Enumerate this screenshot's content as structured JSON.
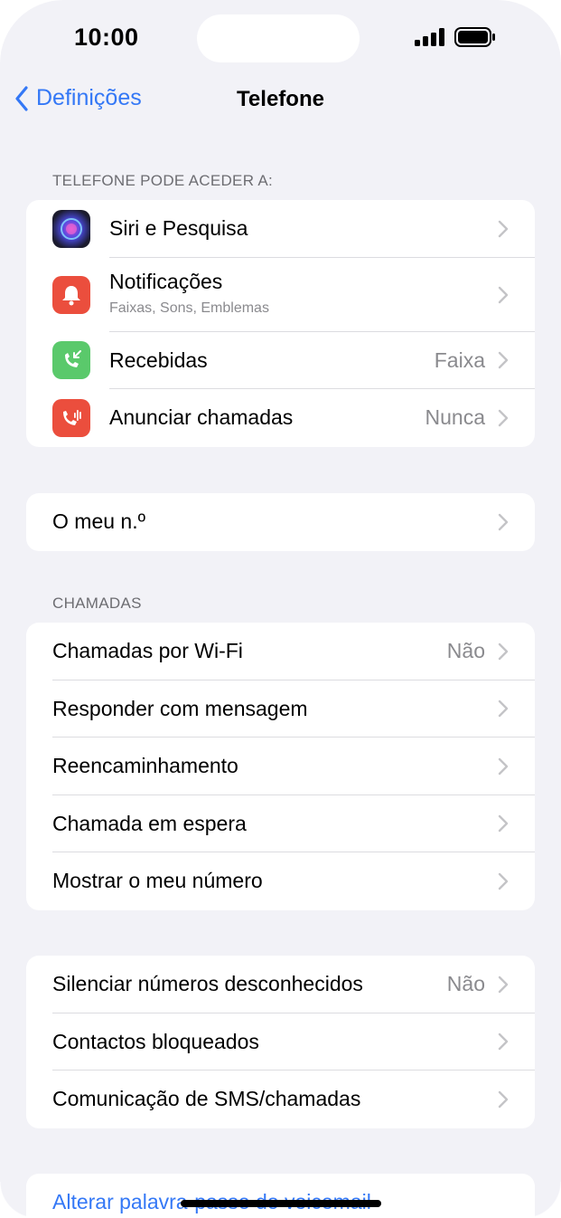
{
  "status": {
    "time": "10:00"
  },
  "nav": {
    "back_label": "Definições",
    "title": "Telefone"
  },
  "section1": {
    "header": "TELEFONE PODE ACEDER A:",
    "rows": [
      {
        "label": "Siri e Pesquisa",
        "icon": "siri-icon"
      },
      {
        "label": "Notificações",
        "sublabel": "Faixas, Sons, Emblemas",
        "icon": "notifications-icon",
        "color": "#eb4e3d"
      },
      {
        "label": "Recebidas",
        "value": "Faixa",
        "icon": "incoming-call-icon",
        "color": "#5ac96b"
      },
      {
        "label": "Anunciar chamadas",
        "value": "Nunca",
        "icon": "announce-calls-icon",
        "color": "#eb4e3d"
      }
    ]
  },
  "section2": {
    "rows": [
      {
        "label": "O meu n.º"
      }
    ]
  },
  "section3": {
    "header": "CHAMADAS",
    "rows": [
      {
        "label": "Chamadas por Wi-Fi",
        "value": "Não"
      },
      {
        "label": "Responder com mensagem"
      },
      {
        "label": "Reencaminhamento"
      },
      {
        "label": "Chamada em espera"
      },
      {
        "label": "Mostrar o meu número"
      }
    ]
  },
  "section4": {
    "rows": [
      {
        "label": "Silenciar números desconhecidos",
        "value": "Não"
      },
      {
        "label": "Contactos bloqueados"
      },
      {
        "label": "Comunicação de SMS/chamadas"
      }
    ]
  },
  "section5": {
    "link": "Alterar palavra-passe do voicemail"
  },
  "colors": {
    "accent": "#3478f6",
    "background": "#f2f2f7",
    "secondary_text": "#8a8a8e"
  }
}
